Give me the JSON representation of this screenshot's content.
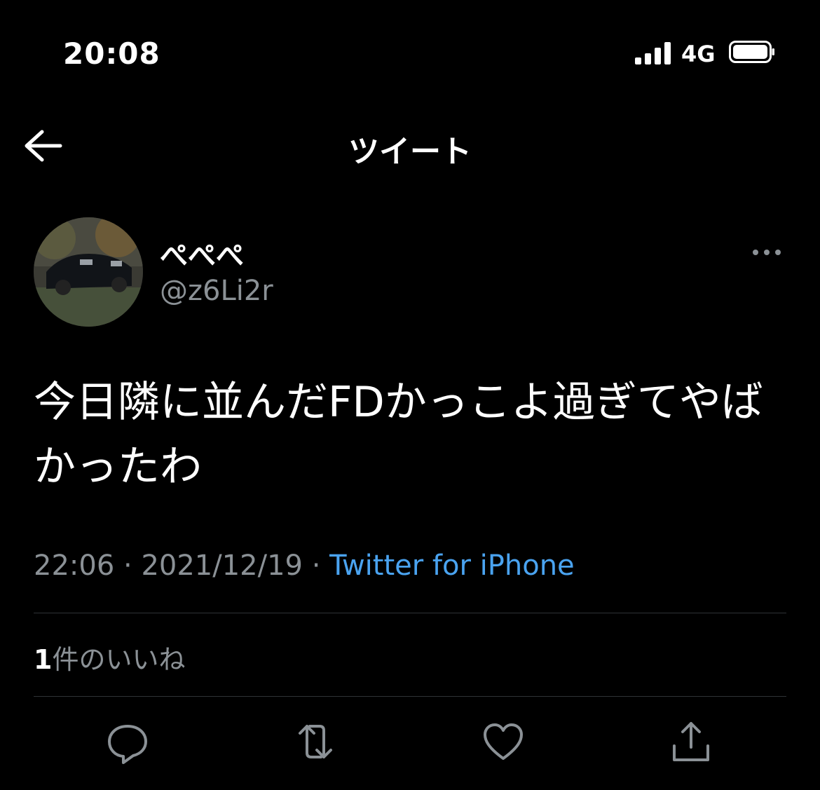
{
  "status_bar": {
    "time": "20:08",
    "network": "4G",
    "signal_bars": 4,
    "battery_level": 1.0
  },
  "header": {
    "back_icon": "arrow-left-icon",
    "title": "ツイート"
  },
  "tweet": {
    "author": {
      "display_name": "ぺぺぺ",
      "handle": "@z6Li2r",
      "avatar_icon": "avatar"
    },
    "text": "今日隣に並んだFDかっこよ過ぎてやばかったわ",
    "timestamp": "22:06",
    "date": "2021/12/19",
    "separator": "·",
    "source": "Twitter for iPhone"
  },
  "engagement": {
    "likes_count": "1",
    "likes_label": "件のいいね"
  },
  "actions": [
    {
      "name": "reply",
      "icon": "reply-icon"
    },
    {
      "name": "retweet",
      "icon": "retweet-icon"
    },
    {
      "name": "like",
      "icon": "heart-icon"
    },
    {
      "name": "share",
      "icon": "share-icon"
    }
  ],
  "colors": {
    "background": "#000000",
    "text": "#ffffff",
    "muted": "#8b9196",
    "link": "#4aa3f0",
    "divider": "#2f3336"
  }
}
